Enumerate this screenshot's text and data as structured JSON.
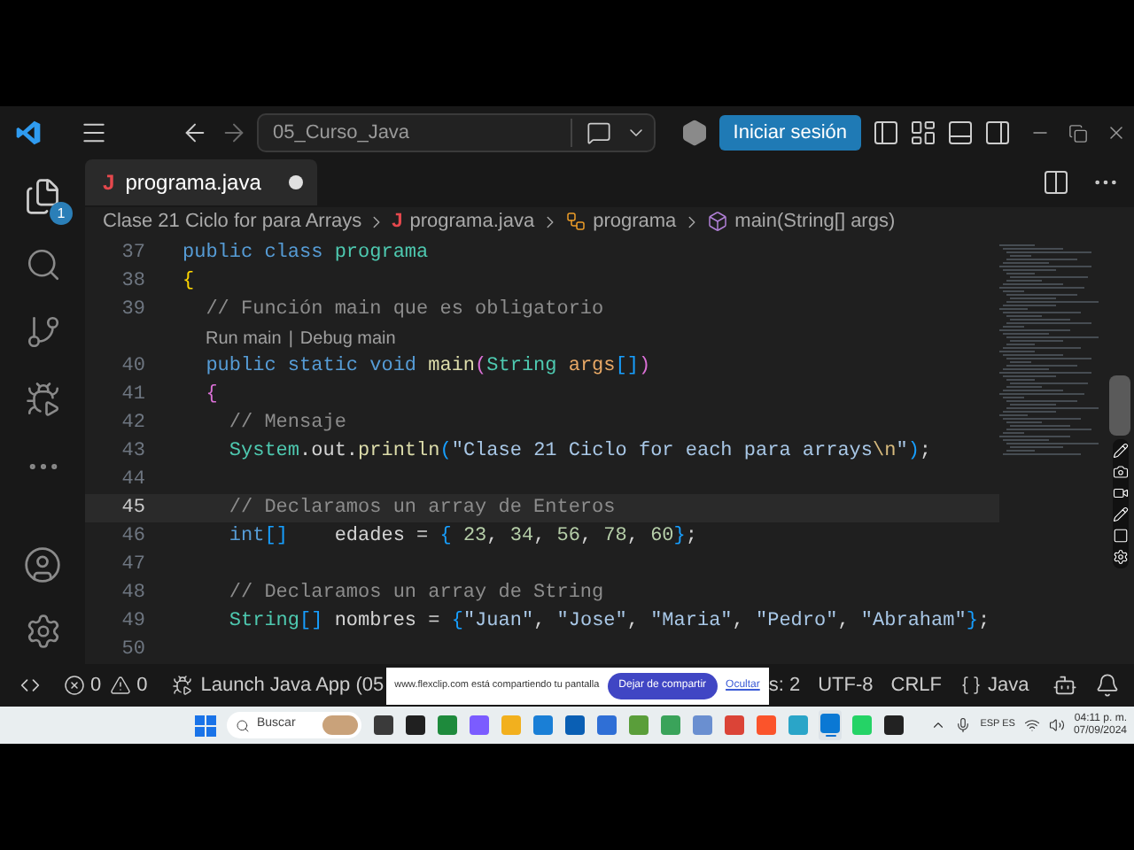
{
  "title_bar": {
    "search": "05_Curso_Java",
    "sign_in_button": "Iniciar sesión"
  },
  "activity_bar": {
    "explorer_badge": "1"
  },
  "tabs": [
    {
      "label": "programa.java",
      "icon_text": "J",
      "selected": true,
      "modified": true
    }
  ],
  "breadcrumbs": [
    {
      "kind": "folder",
      "label": "Clase 21 Ciclo for para Arrays"
    },
    {
      "kind": "file",
      "label": "programa.java",
      "icon_text": "J"
    },
    {
      "kind": "class",
      "label": "programa"
    },
    {
      "kind": "method",
      "label": "main(String[] args)"
    }
  ],
  "editor": {
    "lines": [
      {
        "kind": "code",
        "number": "37",
        "current": false,
        "tokens": [
          {
            "kind": "keyword",
            "text": "public class "
          },
          {
            "kind": "type",
            "text": "programa"
          }
        ]
      },
      {
        "kind": "code",
        "number": "38",
        "current": false,
        "tokens": [
          {
            "kind": "bracket1",
            "text": "{"
          }
        ]
      },
      {
        "kind": "code",
        "number": "39",
        "current": false,
        "tokens": [
          {
            "kind": "comment",
            "text": "  // Función main que es obligatorio"
          }
        ]
      },
      {
        "kind": "codelens",
        "links": [
          "Run main",
          "Debug main"
        ],
        "separator": "|"
      },
      {
        "kind": "code",
        "number": "40",
        "current": false,
        "tokens": [
          {
            "kind": "keyword",
            "text": "  public static void "
          },
          {
            "kind": "function",
            "text": "main"
          },
          {
            "kind": "bracket2",
            "text": "("
          },
          {
            "kind": "type",
            "text": "String "
          },
          {
            "kind": "param",
            "text": "args"
          },
          {
            "kind": "bracket3",
            "text": "[]"
          },
          {
            "kind": "bracket2",
            "text": ")"
          }
        ]
      },
      {
        "kind": "code",
        "number": "41",
        "current": false,
        "tokens": [
          {
            "kind": "bracket2",
            "text": "  {"
          }
        ]
      },
      {
        "kind": "code",
        "number": "42",
        "current": false,
        "tokens": [
          {
            "kind": "comment",
            "text": "    // Mensaje"
          }
        ]
      },
      {
        "kind": "code",
        "number": "43",
        "current": false,
        "tokens": [
          {
            "kind": "type",
            "text": "    System"
          },
          {
            "kind": "plain",
            "text": ".out."
          },
          {
            "kind": "function",
            "text": "println"
          },
          {
            "kind": "bracket3",
            "text": "("
          },
          {
            "kind": "string",
            "text": "\"Clase 21 Ciclo for each para arrays"
          },
          {
            "kind": "escape",
            "text": "\\n"
          },
          {
            "kind": "string",
            "text": "\""
          },
          {
            "kind": "bracket3",
            "text": ")"
          },
          {
            "kind": "plain",
            "text": ";"
          }
        ]
      },
      {
        "kind": "code",
        "number": "44",
        "current": false
      },
      {
        "kind": "code",
        "number": "45",
        "current": true,
        "tokens": [
          {
            "kind": "comment",
            "text": "    // Declaramos un array de Enteros"
          }
        ]
      },
      {
        "kind": "code",
        "number": "46",
        "current": false,
        "tokens": [
          {
            "kind": "keyword",
            "text": "    int"
          },
          {
            "kind": "bracket3",
            "text": "[]    "
          },
          {
            "kind": "plain",
            "text": "edades = "
          },
          {
            "kind": "bracket3",
            "text": "{ "
          },
          {
            "kind": "number",
            "text": "23"
          },
          {
            "kind": "plain",
            "text": ", "
          },
          {
            "kind": "number",
            "text": "34"
          },
          {
            "kind": "plain",
            "text": ", "
          },
          {
            "kind": "number",
            "text": "56"
          },
          {
            "kind": "plain",
            "text": ", "
          },
          {
            "kind": "number",
            "text": "78"
          },
          {
            "kind": "plain",
            "text": ", "
          },
          {
            "kind": "number",
            "text": "60"
          },
          {
            "kind": "bracket3",
            "text": "}"
          },
          {
            "kind": "plain",
            "text": ";"
          }
        ]
      },
      {
        "kind": "code",
        "number": "47",
        "current": false
      },
      {
        "kind": "code",
        "number": "48",
        "current": false,
        "tokens": [
          {
            "kind": "comment",
            "text": "    // Declaramos un array de String"
          }
        ]
      },
      {
        "kind": "code",
        "number": "49",
        "current": false,
        "tokens": [
          {
            "kind": "type",
            "text": "    String"
          },
          {
            "kind": "bracket3",
            "text": "[] "
          },
          {
            "kind": "plain",
            "text": "nombres = "
          },
          {
            "kind": "bracket3",
            "text": "{"
          },
          {
            "kind": "string",
            "text": "\"Juan\""
          },
          {
            "kind": "plain",
            "text": ", "
          },
          {
            "kind": "string",
            "text": "\"Jose\""
          },
          {
            "kind": "plain",
            "text": ", "
          },
          {
            "kind": "string",
            "text": "\"Maria\""
          },
          {
            "kind": "plain",
            "text": ", "
          },
          {
            "kind": "string",
            "text": "\"Pedro\""
          },
          {
            "kind": "plain",
            "text": ", "
          },
          {
            "kind": "string",
            "text": "\"Abraham\""
          },
          {
            "kind": "bracket3",
            "text": "}"
          },
          {
            "kind": "plain",
            "text": ";"
          }
        ]
      },
      {
        "kind": "code",
        "number": "50",
        "current": false
      }
    ]
  },
  "status_bar": {
    "errors": "0",
    "warnings": "0",
    "launch": "Launch Java App (05",
    "spaces": "s: 2",
    "encoding": "UTF-8",
    "eol": "CRLF",
    "language": "Java"
  },
  "share_banner": {
    "message": "www.flexclip.com está compartiendo tu pantalla",
    "stop_button": "Dejar de compartir",
    "hide_link": "Ocultar"
  },
  "taskbar": {
    "search_placeholder": "Buscar",
    "apps": [
      {
        "selected": false
      },
      {
        "selected": false
      },
      {
        "selected": false
      },
      {
        "selected": false
      },
      {
        "selected": false
      },
      {
        "selected": false
      },
      {
        "selected": false
      },
      {
        "selected": false
      },
      {
        "selected": false
      },
      {
        "selected": false
      },
      {
        "selected": false
      },
      {
        "selected": false
      },
      {
        "selected": false
      },
      {
        "selected": false
      },
      {
        "selected": true
      },
      {
        "selected": false
      },
      {
        "selected": false
      }
    ],
    "input_language": "ESP ES",
    "time": "04:11 p. m.",
    "date": "07/09/2024"
  }
}
